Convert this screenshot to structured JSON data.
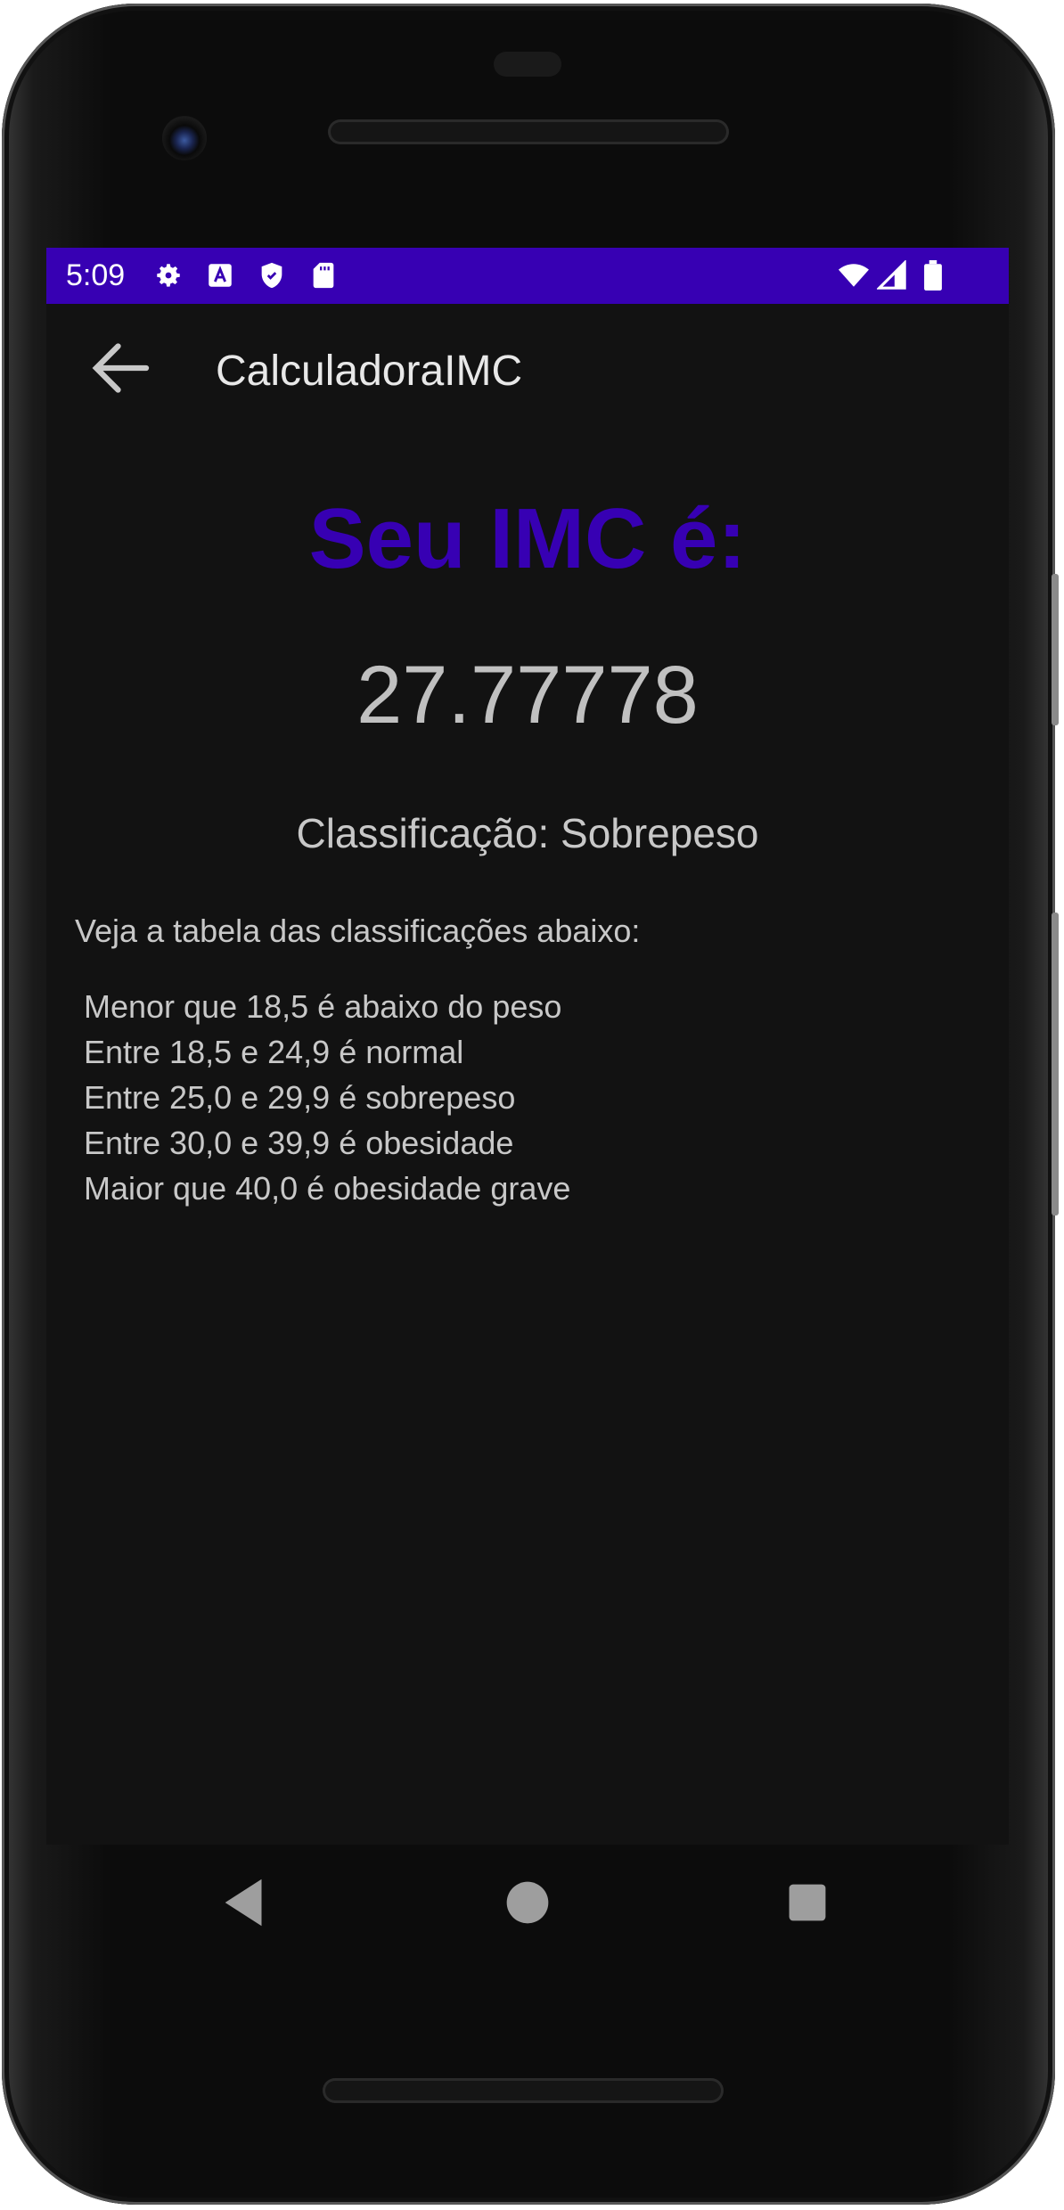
{
  "status_bar": {
    "time": "5:09",
    "left_icons": [
      "gear-icon",
      "font-a-icon",
      "shield-icon",
      "sd-card-icon"
    ],
    "right_icons": [
      "wifi-icon",
      "signal-icon",
      "battery-icon"
    ],
    "background_color": "#3700b3"
  },
  "app_bar": {
    "title": "CalculadoraIMC",
    "back_icon": "arrow-left-icon"
  },
  "main": {
    "heading": "Seu IMC é:",
    "heading_color": "#3700b3",
    "imc_value": "27.77778",
    "classification": "Classificação: Sobrepeso",
    "table_intro": "Veja a tabela das classificações abaixo:",
    "table_rows": [
      "Menor que 18,5 é abaixo do peso",
      "Entre 18,5 e 24,9 é normal",
      "Entre 25,0 e 29,9 é sobrepeso",
      "Entre 30,0 e 39,9 é obesidade",
      "Maior que 40,0 é obesidade grave"
    ]
  },
  "nav_bar": {
    "buttons": [
      "back-triangle-icon",
      "home-circle-icon",
      "recents-square-icon"
    ]
  }
}
